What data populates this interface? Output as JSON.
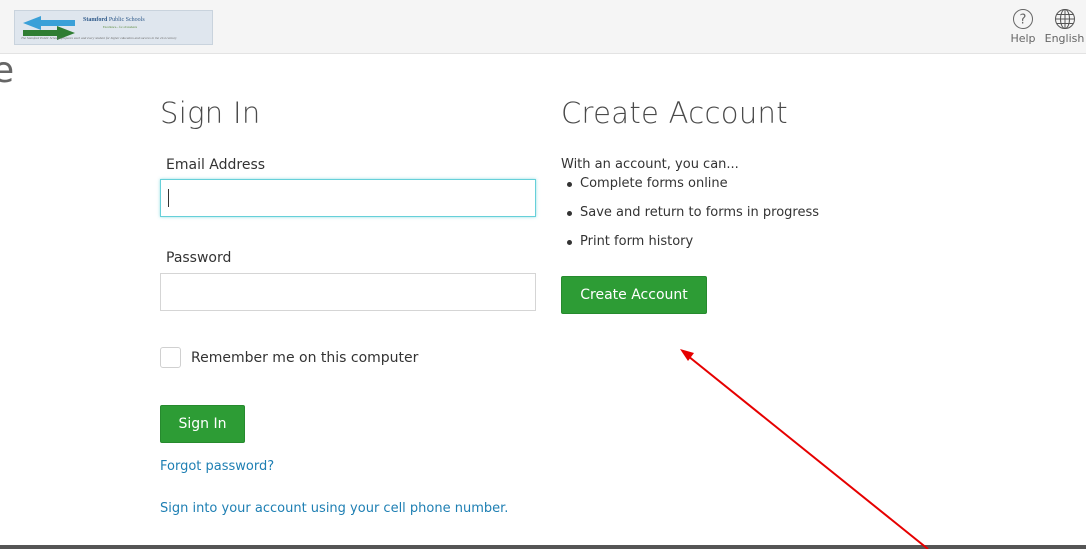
{
  "header": {
    "logo": {
      "name_bold": "Stamford",
      "name_rest": " Public Schools",
      "motto": "Excellence... for all students",
      "tagline": "The Stamford Public Schools prepares each and every student for higher education and success in the 21st century"
    },
    "help_label": "Help",
    "language_label": "English"
  },
  "side_fragment": "e",
  "sign_in": {
    "title": "Sign In",
    "email_label": "Email Address",
    "email_value": "",
    "password_label": "Password",
    "password_value": "",
    "remember_label": "Remember me on this computer",
    "remember_checked": false,
    "button_label": "Sign In",
    "forgot_link": "Forgot password?",
    "phone_link": "Sign into your account using your cell phone number."
  },
  "create_account": {
    "title": "Create Account",
    "intro": "With an account, you can...",
    "benefits": [
      "Complete forms online",
      "Save and return to forms in progress",
      "Print form history"
    ],
    "button_label": "Create Account"
  },
  "colors": {
    "primary_button": "#2d9c35",
    "link": "#1e7fb3",
    "focus_ring": "#66d0d9",
    "annotation_arrow": "#e60000"
  },
  "icons": {
    "help": "question-circle-icon",
    "language": "globe-icon",
    "logo": "double-arrow-logo"
  }
}
